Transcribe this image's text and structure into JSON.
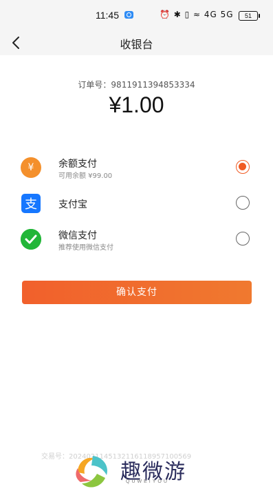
{
  "status_bar": {
    "time": "11:45",
    "icons_text": "⏰ ✱ ▯ ≈ 4G 5G",
    "battery": "51"
  },
  "nav": {
    "title": "收银台",
    "back_icon": "chevron-left-icon"
  },
  "order": {
    "label": "订单号：",
    "number": "9811911394853334",
    "amount": "¥1.00"
  },
  "payment_options": [
    {
      "title": "余额支付",
      "subtitle": "可用余额 ¥99.00",
      "icon": "yuan-icon",
      "selected": true
    },
    {
      "title": "支付宝",
      "subtitle": "",
      "icon": "alipay-icon",
      "selected": false
    },
    {
      "title": "微信支付",
      "subtitle": "推荐使用微信支付",
      "icon": "wechat-icon",
      "selected": false
    }
  ],
  "confirm_label": "确认支付",
  "trade": {
    "label": "交易号：",
    "number": "2024021145132116118957100569"
  },
  "watermark": {
    "text": "趣微游",
    "sub": "QUWEIYOU"
  },
  "colors": {
    "accent": "#f05a22",
    "button": "#f1602c",
    "balance_icon": "#f4902c",
    "alipay": "#1677ff",
    "wechat": "#22b638"
  }
}
